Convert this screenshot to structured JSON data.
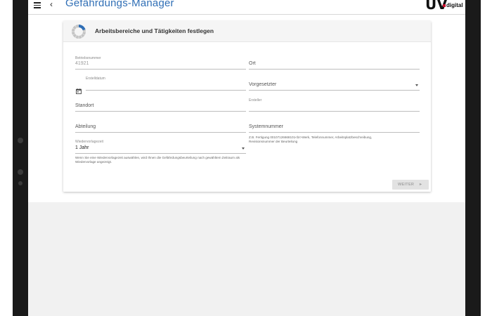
{
  "app": {
    "title": "Gefährdungs-Manager",
    "logo_text": "UV",
    "logo_sub": "digital"
  },
  "card": {
    "title": "Arbeitsbereiche und Tätigkeiten festlegen"
  },
  "form": {
    "betriebsnummer": {
      "label": "Betriebsnummer",
      "value": "41921"
    },
    "ort": {
      "placeholder": "Ort"
    },
    "erstelldatum": {
      "label": "Erstelldatum",
      "value": ""
    },
    "vorgesetzter": {
      "placeholder": "Vorgesetzter"
    },
    "standort": {
      "placeholder": "Standort"
    },
    "ersteller": {
      "label": "Ersteller",
      "value": ""
    },
    "abteilung": {
      "placeholder": "Abteilung"
    },
    "systemnummer": {
      "placeholder": "Systemnummer",
      "hint": "Z.B. Fertigung 00107126668101<br>Werk, Telefonnummer, Arbeitsplatzbeschreibung, Revisionsnummer der Beurteilung"
    },
    "wiedervorlagezeit": {
      "label": "Wiedervorlagezeit",
      "value": "1 Jahr",
      "hint": "Wenn Sie eine Wiedervorlagezeit auswählen, wird Ihnen die Gefährdungsbeurteilung nach gewähltem Zeitraum als Wiedervorlage angezeigt."
    }
  },
  "actions": {
    "weiter_label": "WEITER"
  },
  "icons": {
    "menu": "menu-icon",
    "back": "chevron-left-icon",
    "calendar": "calendar-icon",
    "dropdown": "chevron-down-icon",
    "next": "chevron-right-icon",
    "progress": "progress-ring-icon"
  },
  "colors": {
    "title_blue": "#2f6eb5",
    "logo_red": "#c8102e",
    "ring_blue": "#2f6eb5",
    "ring_gray": "#c4c4c4"
  }
}
